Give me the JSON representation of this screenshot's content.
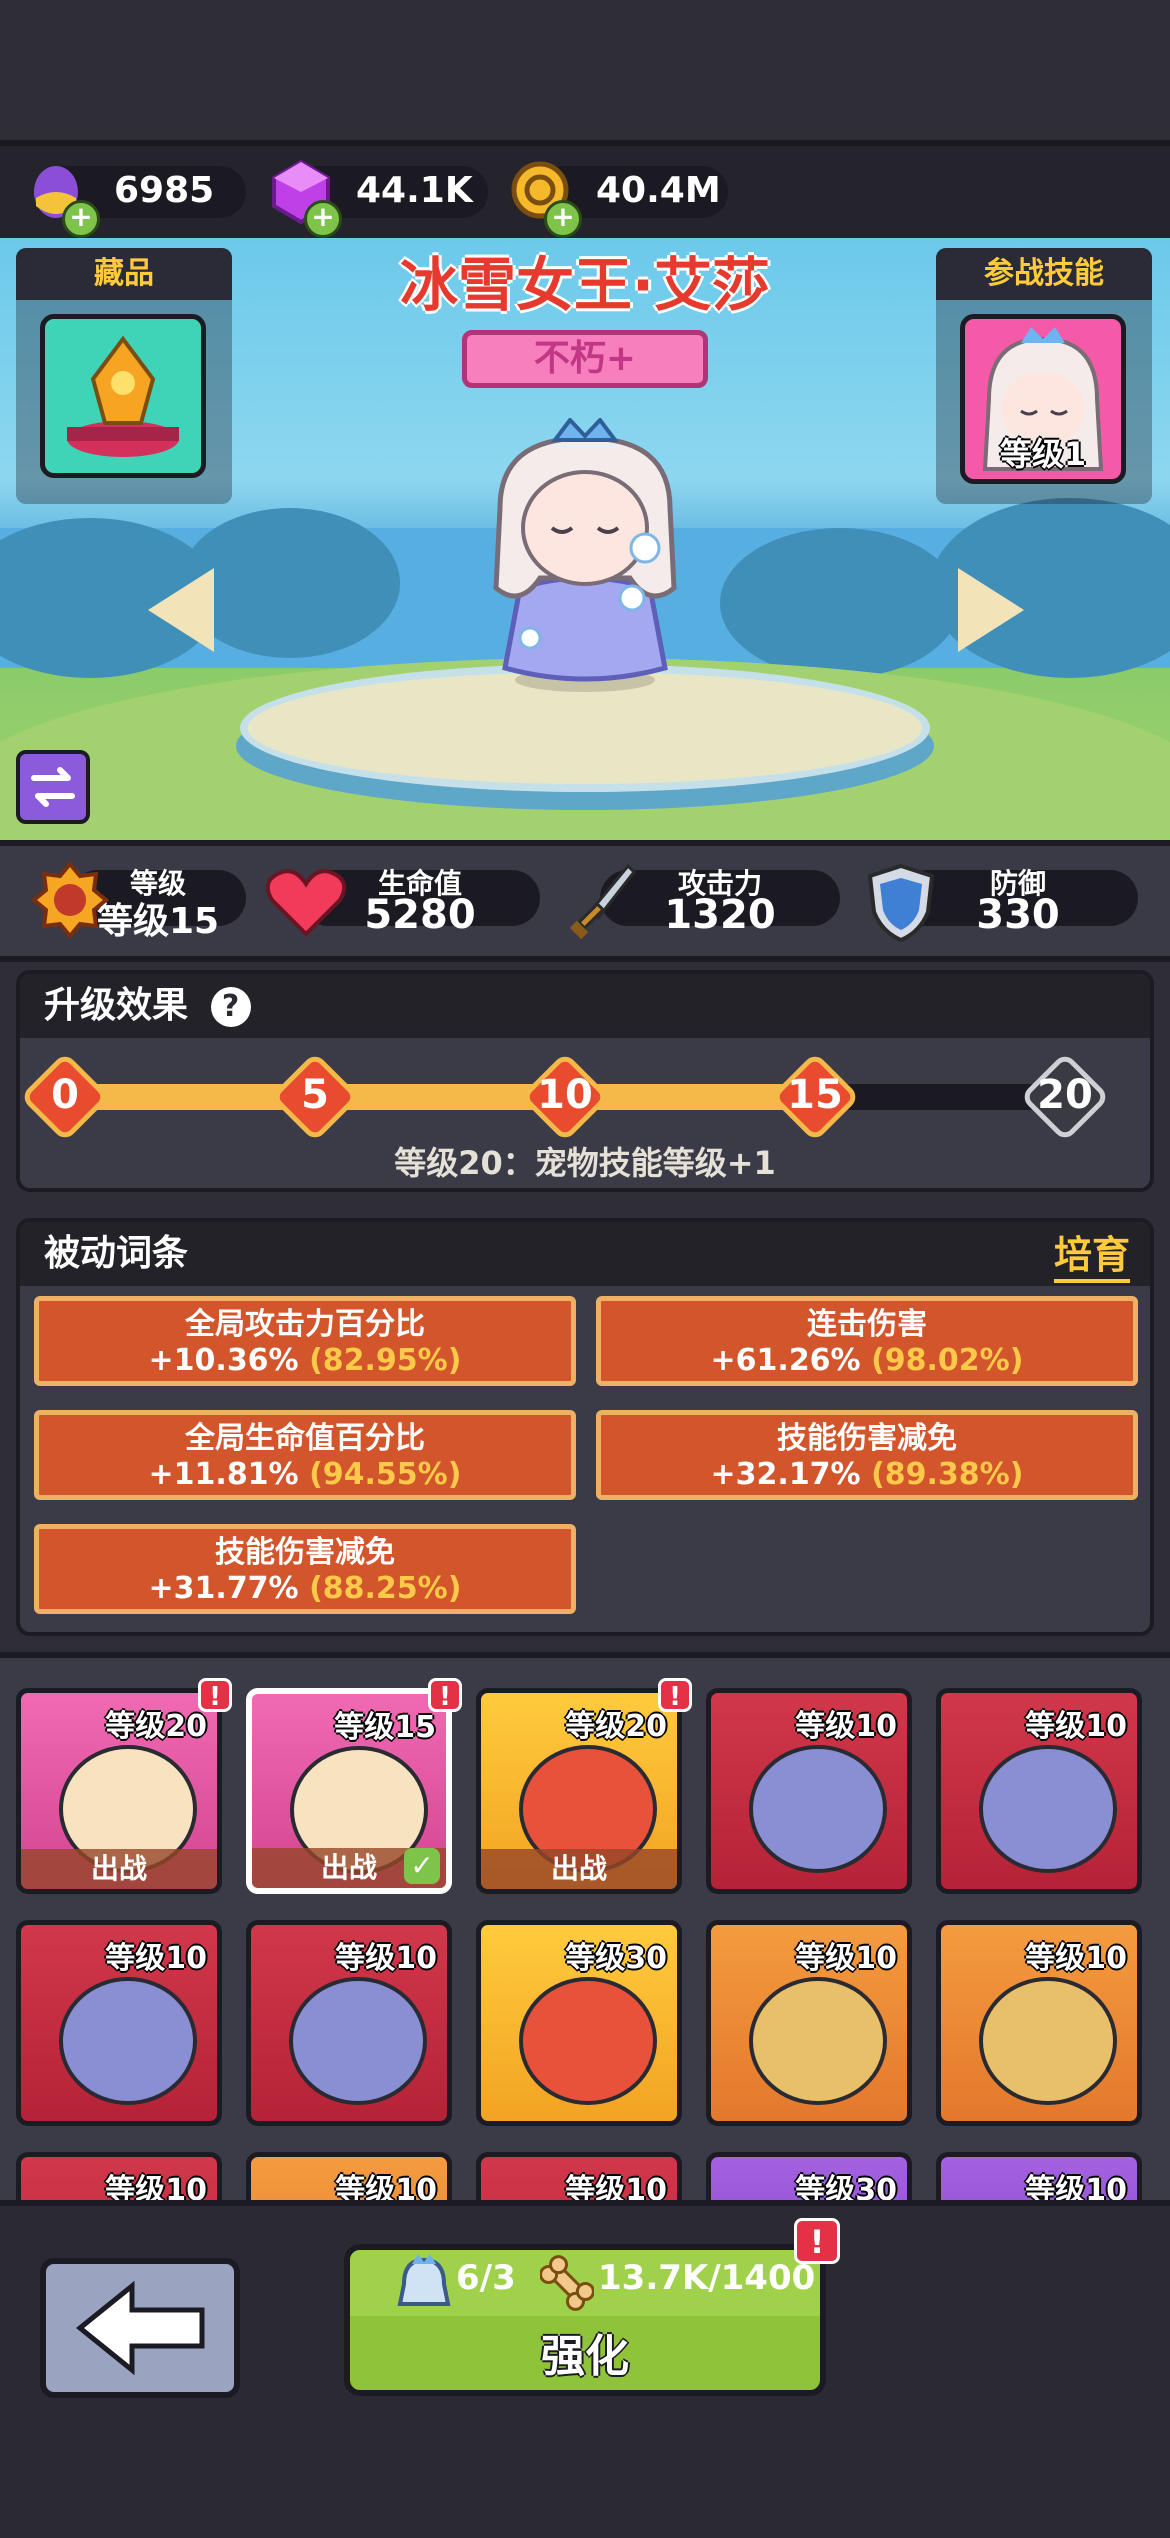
{
  "resources": [
    {
      "icon": "egg-icon",
      "value": "6985"
    },
    {
      "icon": "purple-gem-icon",
      "value": "44.1K"
    },
    {
      "icon": "gold-coin-icon",
      "value": "40.4M"
    }
  ],
  "hero": {
    "name": "冰雪女王·艾莎",
    "rank": "不朽+",
    "collection_label": "藏品",
    "battle_skill_label": "参战技能",
    "skill_level": "等级1"
  },
  "stats": [
    {
      "label": "等级",
      "value": "等级15",
      "icon": "level-badge-icon"
    },
    {
      "label": "生命值",
      "value": "5280",
      "icon": "heart-icon"
    },
    {
      "label": "攻击力",
      "value": "1320",
      "icon": "sword-icon"
    },
    {
      "label": "防御",
      "value": "330",
      "icon": "shield-icon"
    }
  ],
  "upgrade": {
    "title": "升级效果",
    "help": "?",
    "nodes": [
      "0",
      "5",
      "10",
      "15",
      "20"
    ],
    "reached_fraction": 0.75,
    "description": "等级20：宠物技能等级+1"
  },
  "passive": {
    "title": "被动词条",
    "cultivate": "培育",
    "affixes": [
      {
        "name": "全局攻击力百分比",
        "value": "+10.36%",
        "pct": "(82.95%)"
      },
      {
        "name": "连击伤害",
        "value": "+61.26%",
        "pct": "(98.02%)"
      },
      {
        "name": "全局生命值百分比",
        "value": "+11.81%",
        "pct": "(94.55%)"
      },
      {
        "name": "技能伤害减免",
        "value": "+32.17%",
        "pct": "(89.38%)"
      },
      {
        "name": "技能伤害减免",
        "value": "+31.77%",
        "pct": "(88.25%)"
      }
    ]
  },
  "pets": [
    {
      "level": "等级20",
      "tag": "出战",
      "color": "pink",
      "alert": "!"
    },
    {
      "level": "等级15",
      "tag": "出战",
      "color": "pink",
      "alert": "!",
      "selected": true
    },
    {
      "level": "等级20",
      "tag": "出战",
      "color": "gold",
      "alert": "!"
    },
    {
      "level": "等级10",
      "tag": "",
      "color": "red"
    },
    {
      "level": "等级10",
      "tag": "",
      "color": "red"
    },
    {
      "level": "等级10",
      "tag": "",
      "color": "red"
    },
    {
      "level": "等级10",
      "tag": "",
      "color": "red"
    },
    {
      "level": "等级30",
      "tag": "",
      "color": "gold"
    },
    {
      "level": "等级10",
      "tag": "",
      "color": "orange"
    },
    {
      "level": "等级10",
      "tag": "",
      "color": "orange"
    },
    {
      "level": "等级10",
      "tag": "",
      "color": "red"
    },
    {
      "level": "等级10",
      "tag": "",
      "color": "orange"
    },
    {
      "level": "等级10",
      "tag": "",
      "color": "red"
    },
    {
      "level": "等级30",
      "tag": "",
      "color": "purple"
    },
    {
      "level": "等级10",
      "tag": "",
      "color": "purple"
    }
  ],
  "bottom": {
    "shards": "6/3",
    "bones": "13.7K/1400",
    "enhance_label": "强化",
    "alert": "!"
  }
}
